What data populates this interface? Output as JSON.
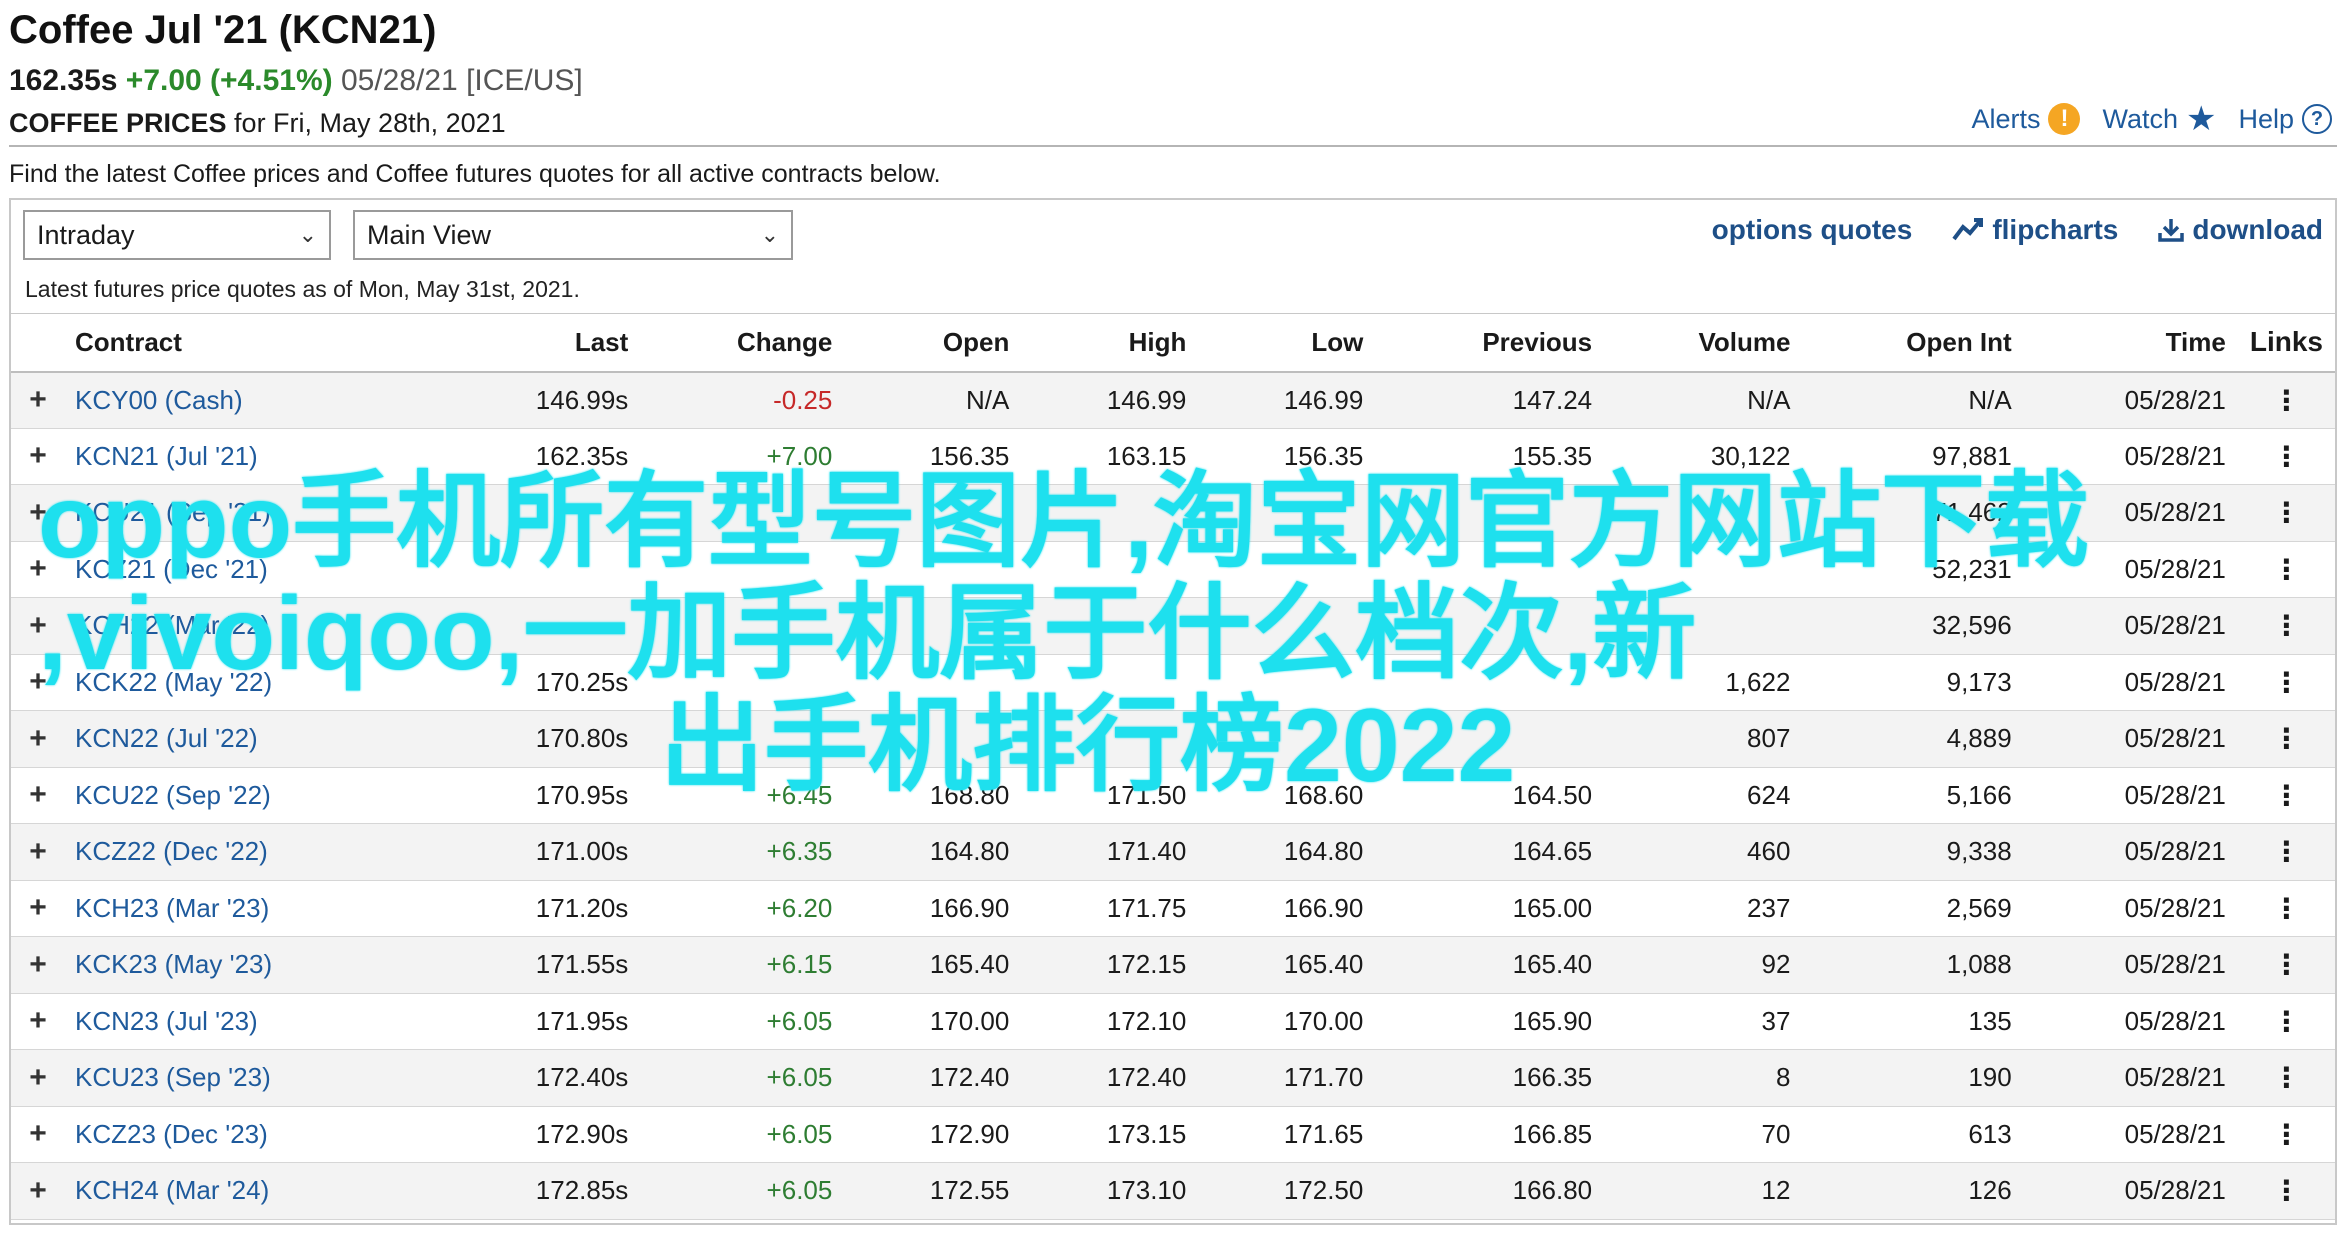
{
  "header": {
    "title": "Coffee Jul '21 (KCN21)",
    "last": "162.35s",
    "change": "+7.00 (+4.51%)",
    "date_exchange": "05/28/21 [ICE/US]",
    "prices_label": "COFFEE PRICES",
    "prices_date": "for Fri, May 28th, 2021"
  },
  "top_actions": {
    "alerts": "Alerts",
    "watch": "Watch",
    "help": "Help"
  },
  "intro": "Find the latest Coffee prices and Coffee futures quotes for all active contracts below.",
  "controls": {
    "period": "Intraday",
    "view": "Main View"
  },
  "panel_links": {
    "options": "options quotes",
    "flipcharts": "flipcharts",
    "download": "download"
  },
  "as_of": "Latest futures price quotes as of Mon, May 31st, 2021.",
  "table": {
    "headers": [
      "Contract",
      "Last",
      "Change",
      "Open",
      "High",
      "Low",
      "Previous",
      "Volume",
      "Open Int",
      "Time",
      "Links"
    ],
    "rows": [
      [
        "KCY00 (Cash)",
        "146.99s",
        "-0.25",
        "N/A",
        "146.99",
        "146.99",
        "147.24",
        "N/A",
        "N/A",
        "05/28/21"
      ],
      [
        "KCN21 (Jul '21)",
        "162.35s",
        "+7.00",
        "156.35",
        "163.15",
        "156.35",
        "155.35",
        "30,122",
        "97,881",
        "05/28/21"
      ],
      [
        "KCU21 (Sep '21)",
        "",
        "",
        "",
        "",
        "",
        "",
        "",
        "71,462",
        "05/28/21"
      ],
      [
        "KCZ21 (Dec '21)",
        "",
        "",
        "",
        "",
        "",
        "",
        "",
        "52,231",
        "05/28/21"
      ],
      [
        "KCH22 (Mar '22)",
        "",
        "",
        "",
        "",
        "",
        "",
        "",
        "32,596",
        "05/28/21"
      ],
      [
        "KCK22 (May '22)",
        "170.25s",
        "",
        "",
        "",
        "",
        "",
        "1,622",
        "9,173",
        "05/28/21"
      ],
      [
        "KCN22 (Jul '22)",
        "170.80s",
        "",
        "",
        "",
        "",
        "",
        "807",
        "4,889",
        "05/28/21"
      ],
      [
        "KCU22 (Sep '22)",
        "170.95s",
        "+6.45",
        "168.80",
        "171.50",
        "168.60",
        "164.50",
        "624",
        "5,166",
        "05/28/21"
      ],
      [
        "KCZ22 (Dec '22)",
        "171.00s",
        "+6.35",
        "164.80",
        "171.40",
        "164.80",
        "164.65",
        "460",
        "9,338",
        "05/28/21"
      ],
      [
        "KCH23 (Mar '23)",
        "171.20s",
        "+6.20",
        "166.90",
        "171.75",
        "166.90",
        "165.00",
        "237",
        "2,569",
        "05/28/21"
      ],
      [
        "KCK23 (May '23)",
        "171.55s",
        "+6.15",
        "165.40",
        "172.15",
        "165.40",
        "165.40",
        "92",
        "1,088",
        "05/28/21"
      ],
      [
        "KCN23 (Jul '23)",
        "171.95s",
        "+6.05",
        "170.00",
        "172.10",
        "170.00",
        "165.90",
        "37",
        "135",
        "05/28/21"
      ],
      [
        "KCU23 (Sep '23)",
        "172.40s",
        "+6.05",
        "172.40",
        "172.40",
        "171.70",
        "166.35",
        "8",
        "190",
        "05/28/21"
      ],
      [
        "KCZ23 (Dec '23)",
        "172.90s",
        "+6.05",
        "172.90",
        "173.15",
        "171.65",
        "166.85",
        "70",
        "613",
        "05/28/21"
      ],
      [
        "KCH24 (Mar '24)",
        "172.85s",
        "+6.05",
        "172.55",
        "173.10",
        "172.50",
        "166.80",
        "12",
        "126",
        "05/28/21"
      ]
    ]
  },
  "watermark": {
    "line1": "oppo手机所有型号图片,淘宝网官方网站下载",
    "line2": ",vivoiqoo,一加手机属于什么档次,新",
    "line3": "出手机排行榜2022"
  },
  "colors": {
    "link": "#1e5a9c",
    "positive": "#2e7d32",
    "negative": "#c62828",
    "watermark": "#1ee0ee"
  }
}
